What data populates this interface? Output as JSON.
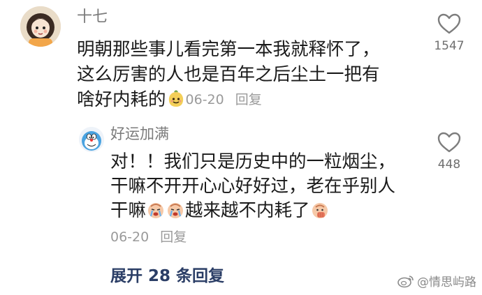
{
  "main_comment": {
    "username": "十七",
    "lines": [
      "明朝那些事儿看完第一本我就释怀了，",
      "这么厉害的人也是百年之后尘土一把有",
      "啥好内耗的"
    ],
    "date": "06-20",
    "reply_label": "回复",
    "like_count": "1547",
    "emoji": "smiling-bean-icon"
  },
  "sub_reply": {
    "username": "好运加满",
    "lines": [
      "对！！我们只是历史中的一粒烟尘，",
      "干嘛不开开心心好好过，老在乎别人",
      "干嘛",
      "越来越不内耗了"
    ],
    "date": "06-20",
    "reply_label": "回复",
    "like_count": "448",
    "emojis": [
      "crying-face-icon",
      "crying-face-icon",
      "face-palm-icon"
    ]
  },
  "expand_label": "展开 28 条回复",
  "watermark": "@情思屿路",
  "colors": {
    "username": "#7b7b7b",
    "text": "#1a1a1a",
    "meta": "#9a9a9a",
    "link": "#2b3e66"
  }
}
